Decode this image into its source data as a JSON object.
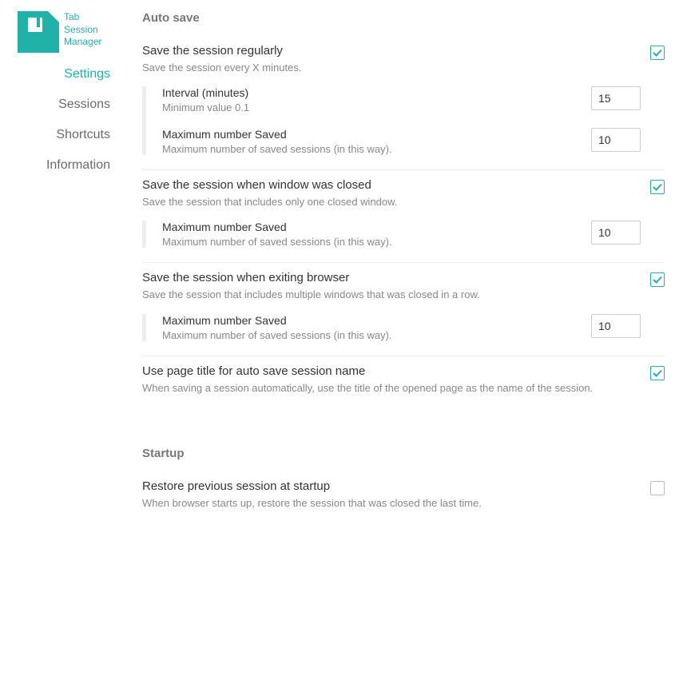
{
  "app": {
    "name_line1": "Tab",
    "name_line2": "Session",
    "name_line3": "Manager"
  },
  "sidebar": {
    "items": [
      {
        "label": "Settings",
        "active": true
      },
      {
        "label": "Sessions",
        "active": false
      },
      {
        "label": "Shortcuts",
        "active": false
      },
      {
        "label": "Information",
        "active": false
      }
    ]
  },
  "sections": {
    "autosave": {
      "heading": "Auto save",
      "regular": {
        "title": "Save the session regularly",
        "desc": "Save the session every X minutes.",
        "checked": true,
        "interval": {
          "label": "Interval (minutes)",
          "desc": "Minimum value 0.1",
          "value": "15"
        },
        "max": {
          "label": "Maximum number Saved",
          "desc": "Maximum number of saved sessions (in this way).",
          "value": "10"
        }
      },
      "winclose": {
        "title": "Save the session when window was closed",
        "desc": "Save the session that includes only one closed window.",
        "checked": true,
        "max": {
          "label": "Maximum number Saved",
          "desc": "Maximum number of saved sessions (in this way).",
          "value": "10"
        }
      },
      "exit": {
        "title": "Save the session when exiting browser",
        "desc": "Save the session that includes multiple windows that was closed in a row.",
        "checked": true,
        "max": {
          "label": "Maximum number Saved",
          "desc": "Maximum number of saved sessions (in this way).",
          "value": "10"
        }
      },
      "pagetitle": {
        "title": "Use page title for auto save session name",
        "desc": "When saving a session automatically, use the title of the opened page as the name of the session.",
        "checked": true
      }
    },
    "startup": {
      "heading": "Startup",
      "restore": {
        "title": "Restore previous session at startup",
        "desc": "When browser starts up, restore the session that was closed the last time.",
        "checked": false
      }
    }
  }
}
